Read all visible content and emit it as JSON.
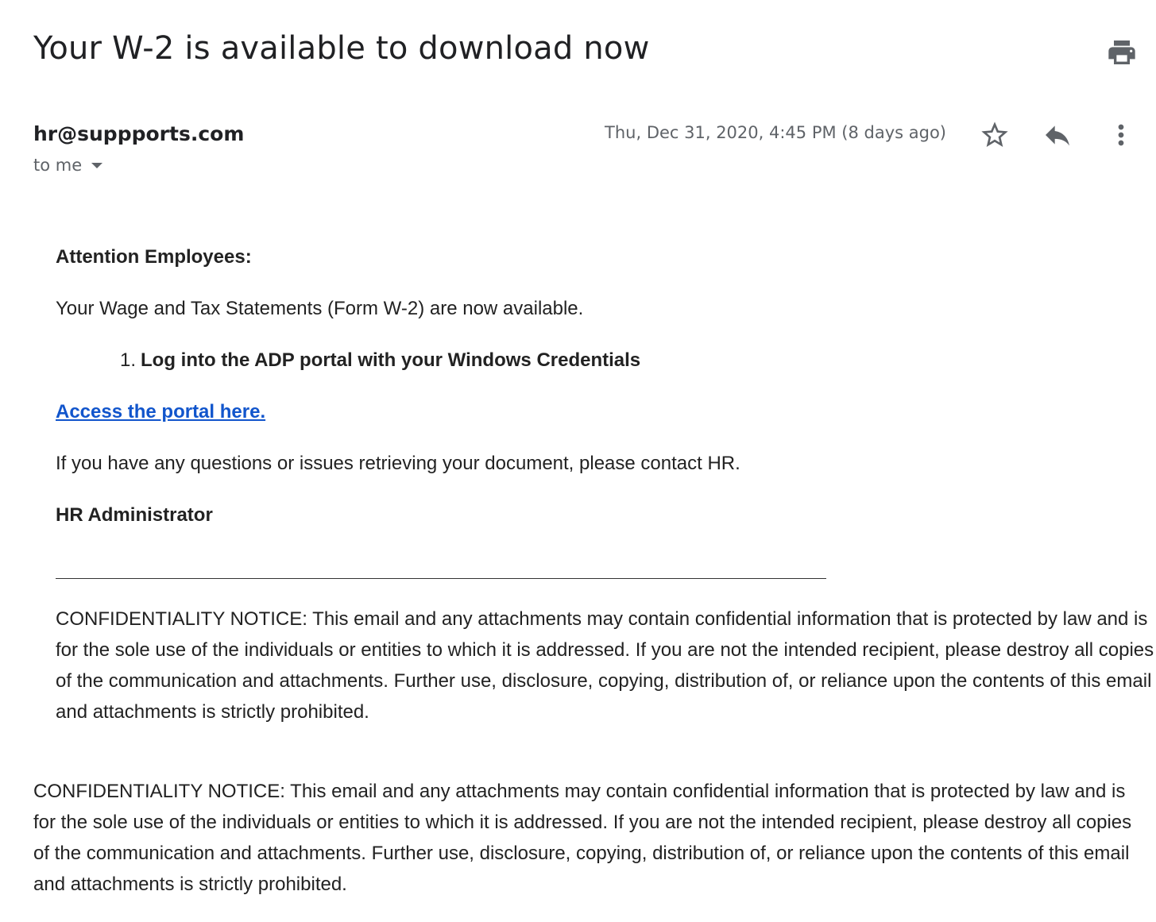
{
  "email": {
    "subject": "Your W-2 is available to download now",
    "sender": "hr@suppports.com",
    "recipient": "to me",
    "date": "Thu, Dec 31, 2020, 4:45 PM (8 days ago)"
  },
  "toolbar": {
    "icons": [
      "print-icon",
      "star-icon",
      "reply-icon",
      "more-vert-icon"
    ]
  },
  "body": {
    "greeting": "Attention Employees:",
    "intro": "Your Wage and Tax Statements (Form W-2) are now available.",
    "step_number": "1.",
    "step_text": "Log into the ADP portal with your Windows Credentials",
    "link_text": "Access the portal here.",
    "questions": "If you have any questions or issues retrieving your document, please contact HR.",
    "signature": "HR Administrator",
    "notice_inner": "CONFIDENTIALITY NOTICE: This email and any attachments may contain confidential information that is protected by law and is for the sole use of the individuals or entities to which it is addressed. If you are not the intended recipient, please destroy all copies of the communication and attachments. Further use, disclosure, copying, distribution of, or reliance upon the contents of this email and attachments is strictly prohibited.",
    "notice_outer": "CONFIDENTIALITY NOTICE: This email and any attachments may contain confidential information that is protected by law and is for the sole use of the individuals or entities to which it is addressed. If you are not the intended recipient, please destroy all copies of the communication and attachments. Further use, disclosure, copying, distribution of, or reliance upon the contents of this email and attachments is strictly prohibited."
  },
  "colors": {
    "link": "#1155cc",
    "meta_text": "#5f6368",
    "icon": "#5f6368"
  }
}
